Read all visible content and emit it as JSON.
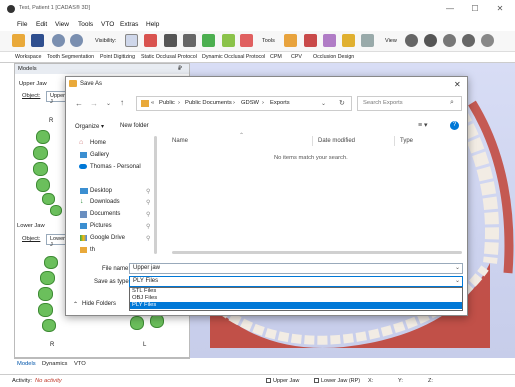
{
  "app": {
    "title": "Test, Patient 1 [CADAS® 3D]"
  },
  "window": {
    "minimize": "—",
    "maximize": "☐",
    "close": "✕"
  },
  "menu": [
    "File",
    "Edit",
    "View",
    "Tools",
    "VTO",
    "Extras",
    "Help"
  ],
  "toolbar": {
    "visibility": "Visibility:",
    "tools": "Tools",
    "view": "View"
  },
  "tabs": [
    "Workspace",
    "Tooth Segmentation",
    "Point Digitizing",
    "Static Occlusal Protocol",
    "Dynamic Occlusal Protocol",
    "CPM",
    "CPV",
    "Occlusion Design"
  ],
  "panel": {
    "title": "Models",
    "pin": "₽",
    "upper_jaw": "Upper Jaw",
    "object_label": "Object:",
    "upper_object": "Upper J",
    "lower_jaw": "Lower Jaw",
    "lower_object": "Lower J",
    "r_upper": "R",
    "r_lower": "R",
    "l_lower": "L"
  },
  "bottom_tabs": [
    "Models",
    "Dynamics",
    "VTO"
  ],
  "status": {
    "activity": "Activity:",
    "activity_value": "No activity",
    "upper": "Upper Jaw",
    "lower": "Lower Jaw (RP)",
    "x": "X:",
    "y": "Y:",
    "z": "Z:"
  },
  "dialog": {
    "title": "Save As",
    "close": "✕",
    "path": [
      "Public",
      "Public Documents",
      "GDSW",
      "Exports"
    ],
    "search_placeholder": "Search Exports",
    "organize": "Organize ▾",
    "new_folder": "New folder",
    "nav": [
      "Home",
      "Gallery",
      "Thomas - Personal",
      "Desktop",
      "Downloads",
      "Documents",
      "Pictures",
      "Google Drive",
      "th"
    ],
    "columns": {
      "name": "Name",
      "date": "Date modified",
      "type": "Type"
    },
    "empty": "No items match your search.",
    "file_name_label": "File name:",
    "file_name": "Upper jaw",
    "save_type_label": "Save as type:",
    "save_type": "PLY Files",
    "hide_folders": "Hide Folders",
    "type_options": [
      "STL Files",
      "OBJ Files",
      "PLY Files"
    ],
    "selected_option": 2
  },
  "colors": {
    "accent": "#0078d7",
    "tooth": "#6bbf5c",
    "gum": "#c0392b",
    "tooth_3d": "#f2ece4"
  }
}
